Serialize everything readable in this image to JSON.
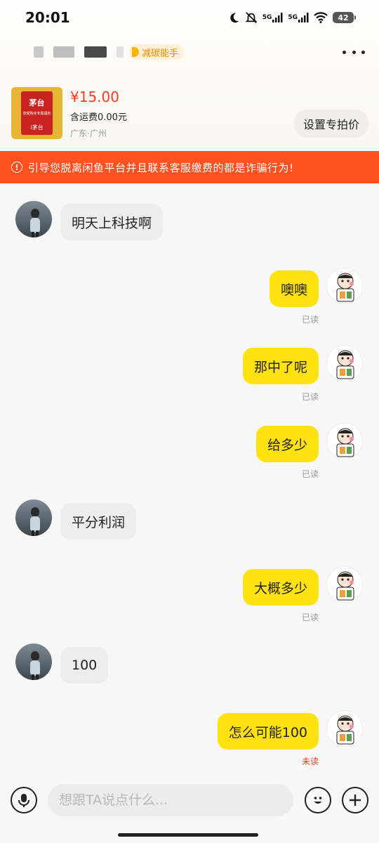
{
  "status_bar": {
    "time": "20:01",
    "net1": "5G",
    "net2": "5G",
    "battery": "42"
  },
  "header": {
    "badge": "减碳能手"
  },
  "product": {
    "price": "¥15.00",
    "shipping": "含运费0.00元",
    "location": "广东·广州",
    "thumb_brand": "茅台",
    "thumb_sub": "享受购买专属福利",
    "thumb_tag": "i茅台",
    "special_price_button": "设置专拍价"
  },
  "warning": {
    "text": "引导您脱离闲鱼平台并且联系客服缴费的都是诈骗行为!"
  },
  "messages": [
    {
      "side": "in",
      "text": "明天上科技啊"
    },
    {
      "side": "out",
      "text": "噢噢",
      "status": "已读"
    },
    {
      "side": "out",
      "text": "那中了呢",
      "status": "已读"
    },
    {
      "side": "out",
      "text": "给多少",
      "status": "已读"
    },
    {
      "side": "in",
      "text": "平分利润"
    },
    {
      "side": "out",
      "text": "大概多少",
      "status": "已读"
    },
    {
      "side": "in",
      "text": "100"
    },
    {
      "side": "out",
      "text": "怎么可能100",
      "status": "未读"
    }
  ],
  "input": {
    "placeholder": "想跟TA说点什么..."
  },
  "icons": {
    "voice": "microphone-icon",
    "emoji": "smiley-icon",
    "plus": "plus-icon",
    "more": "more-dots-icon",
    "warning": "exclamation-circle-icon"
  },
  "colors": {
    "warning_bg": "#fe5122",
    "outgoing_bubble": "#ffe20f",
    "incoming_bubble": "#ededed",
    "price": "#ff3b1f"
  }
}
